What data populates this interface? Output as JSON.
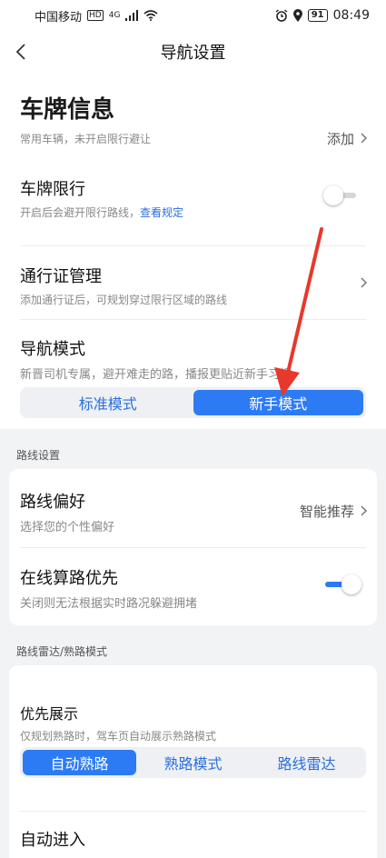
{
  "status_bar": {
    "carrier": "中国移动",
    "hd": "HD",
    "net": "4G",
    "battery": "91",
    "time": "08:49"
  },
  "nav": {
    "title": "导航设置"
  },
  "plate_info": {
    "title": "车牌信息",
    "subtitle": "常用车辆，未开启限行避让",
    "action": "添加"
  },
  "plate_limit": {
    "title": "车牌限行",
    "subtitle": "开启后会避开限行路线，",
    "link": "查看规定",
    "enabled": false
  },
  "permit": {
    "title": "通行证管理",
    "subtitle": "添加通行证后，可规划穿过限行区域的路线"
  },
  "nav_mode": {
    "title": "导航模式",
    "subtitle": "新晋司机专属，避开难走的路，播报更贴近新手习惯",
    "options": [
      "标准模式",
      "新手模式"
    ],
    "selected": "新手模式"
  },
  "route_section": {
    "label": "路线设置"
  },
  "route_pref": {
    "title": "路线偏好",
    "subtitle": "选择您的个性偏好",
    "value": "智能推荐"
  },
  "online_route": {
    "title": "在线算路优先",
    "subtitle": "关闭则无法根据实时路况躲避拥堵",
    "enabled": true
  },
  "radar_section": {
    "label": "路线雷达/熟路模式"
  },
  "priority_display": {
    "title": "优先展示",
    "subtitle": "仅规划熟路时，驾车页自动展示熟路模式",
    "options": [
      "自动熟路",
      "熟路模式",
      "路线雷达"
    ],
    "selected": "自动熟路"
  },
  "auto_enter": {
    "title": "自动进入"
  },
  "colors": {
    "accent": "#2d7bf4",
    "annotation_arrow": "#e8382c"
  }
}
